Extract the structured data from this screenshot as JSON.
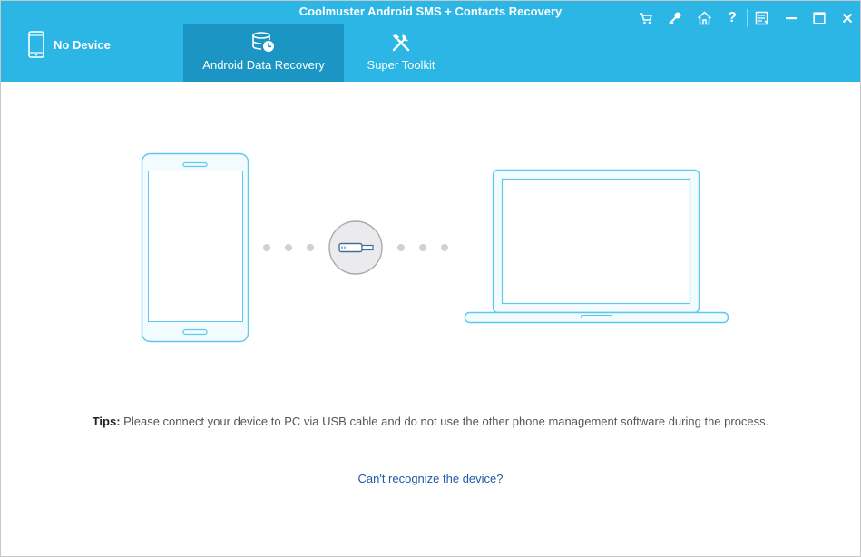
{
  "window": {
    "title": "Coolmuster Android SMS + Contacts Recovery",
    "controls": [
      "cart-icon",
      "key-icon",
      "home-icon",
      "help-icon",
      "feedback-icon",
      "minimize-icon",
      "maximize-icon",
      "close-icon"
    ]
  },
  "device": {
    "status": "No Device"
  },
  "tabs": [
    {
      "label": "Android Data Recovery",
      "icon": "database-recovery-icon",
      "active": true
    },
    {
      "label": "Super Toolkit",
      "icon": "tools-icon",
      "active": false
    }
  ],
  "tips": {
    "prefix": "Tips:",
    "text": "Please connect your device to PC via USB cable and do not use the other phone management software during the process."
  },
  "help_link": "Can't recognize the device?",
  "colors": {
    "header": "#2bb6e6",
    "active_tab": "#1b95c3",
    "outline": "#5ec8ee",
    "screen_fill": "#f2fbfe",
    "link": "#1f5aa8"
  }
}
